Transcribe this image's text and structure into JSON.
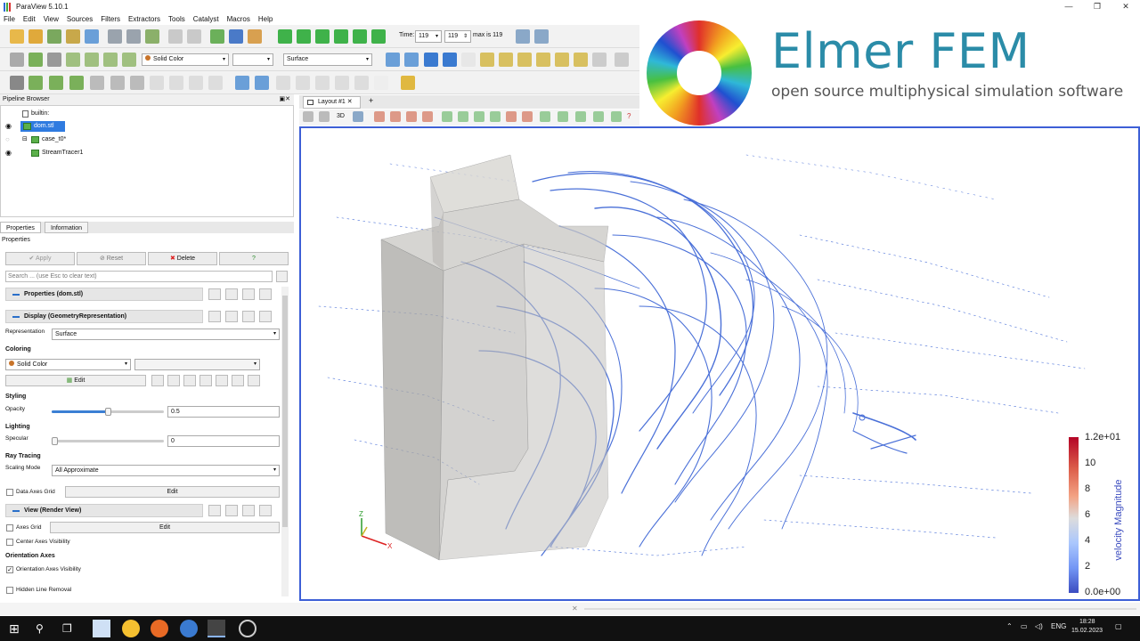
{
  "window": {
    "title": "ParaView 5.10.1",
    "controls": [
      "—",
      "❐",
      "✕"
    ]
  },
  "menu": [
    "File",
    "Edit",
    "View",
    "Sources",
    "Filters",
    "Extractors",
    "Tools",
    "Catalyst",
    "Macros",
    "Help"
  ],
  "toolbar": {
    "time_label": "Time:",
    "time_value": "119",
    "time_step": "119",
    "max_label": "max is 119",
    "coloring_select": "Solid Color",
    "representation_select": "Surface"
  },
  "banner": {
    "title": "Elmer FEM",
    "subtitle": "open source multiphysical simulation software"
  },
  "pipeline": {
    "header": "Pipeline Browser",
    "items": [
      {
        "label": "builtin:",
        "visible": false
      },
      {
        "label": "dom.stl",
        "visible": true,
        "selected": true
      },
      {
        "label": "case_t0*",
        "visible": false
      },
      {
        "label": "StreamTracer1",
        "visible": true
      }
    ]
  },
  "properties_panel": {
    "tabs": [
      "Properties",
      "Information"
    ],
    "header": "Properties",
    "buttons": {
      "apply": "Apply",
      "reset": "Reset",
      "delete": "Delete",
      "help": "?"
    },
    "search_placeholder": "Search ... (use Esc to clear text)",
    "sections": {
      "properties": "Properties (dom.stl)",
      "display": "Display (GeometryRepresentation)",
      "view": "View (Render View)"
    },
    "representation_label": "Representation",
    "representation_value": "Surface",
    "coloring_group": "Coloring",
    "coloring_value": "Solid Color",
    "edit_label": "Edit",
    "styling_group": "Styling",
    "opacity_label": "Opacity",
    "opacity_value": "0.5",
    "opacity_level": 0.5,
    "lighting_group": "Lighting",
    "specular_label": "Specular",
    "specular_value": "0",
    "raytracing_group": "Ray Tracing",
    "scaling_mode_label": "Scaling Mode",
    "scaling_mode_value": "All Approximate",
    "data_axes_grid_label": "Data Axes Grid",
    "data_axes_grid_edit": "Edit",
    "axes_grid_label": "Axes Grid",
    "axes_grid_edit": "Edit",
    "center_axes_label": "Center Axes Visibility",
    "orientation_group": "Orientation Axes",
    "orientation_visibility_label": "Orientation Axes Visibility",
    "orientation_visibility_checked": true,
    "hidden_line_label": "Hidden Line Removal"
  },
  "view": {
    "layout_tab": "Layout #1",
    "add_tab": "+",
    "mode_3d": "3D"
  },
  "legend": {
    "title": "velocity Magnitude",
    "ticks": [
      "1.2e+01",
      "10",
      "8",
      "6",
      "4",
      "2",
      "0.0e+00"
    ],
    "colors": {
      "high": "#b40426",
      "mid": "#dddcdc",
      "low": "#3b4cc0"
    }
  },
  "taskbar": {
    "language": "ENG",
    "time": "18:28",
    "date": "15.02.2023"
  }
}
